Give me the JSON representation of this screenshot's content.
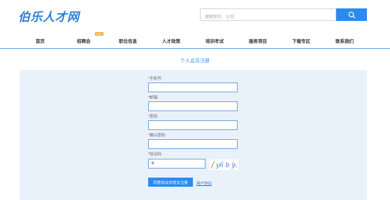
{
  "header": {
    "logo_text": "伯乐人才网",
    "search_placeholder": "搜索职位、公司"
  },
  "nav": {
    "items": [
      {
        "label": "首页"
      },
      {
        "label": "招聘会",
        "badge": "HOT"
      },
      {
        "label": "职位信息"
      },
      {
        "label": "人才政策"
      },
      {
        "label": "培训考试"
      },
      {
        "label": "服务项目"
      },
      {
        "label": "下载专区"
      },
      {
        "label": "联系我们"
      }
    ]
  },
  "form": {
    "title": "个人会员注册",
    "fields": {
      "phone": {
        "required_mark": "*",
        "label": "手机号:",
        "value": ""
      },
      "email": {
        "required_mark": "*",
        "label": "邮箱:",
        "value": ""
      },
      "password": {
        "required_mark": "*",
        "label": "密码:",
        "value": ""
      },
      "confirm_password": {
        "required_mark": "*",
        "label": "确认密码:",
        "value": ""
      },
      "captcha": {
        "required_mark": "*",
        "label": "验证码:",
        "value": "8"
      }
    },
    "captcha_image_text": "y6 b y",
    "submit_label": "同意协议并提交注册",
    "agreement_link": "用户协议"
  },
  "colors": {
    "brand": "#2b7fd6",
    "button": "#2b8af0",
    "panel_bg": "#e9f1fb",
    "required": "#e23b3b"
  }
}
